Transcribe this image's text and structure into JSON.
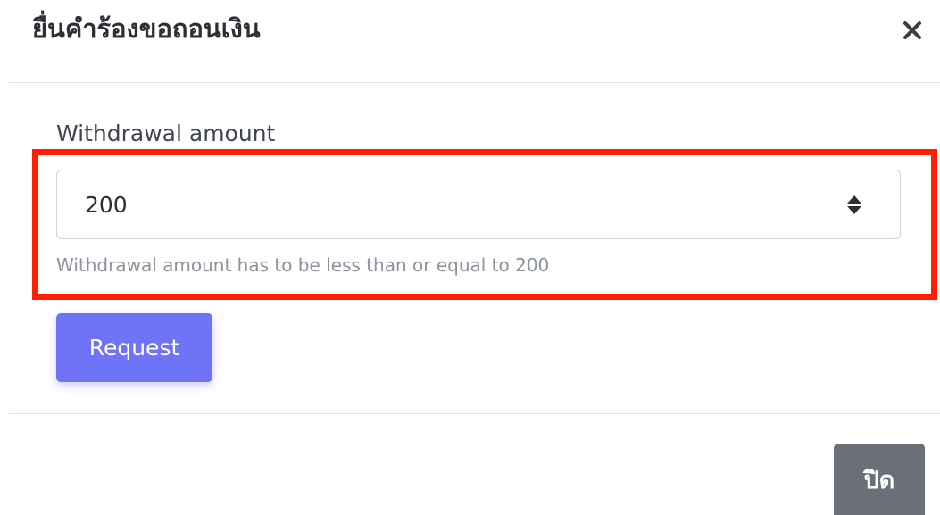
{
  "modal": {
    "title": "ยื่นคำร้องขอถอนเงิน",
    "close_icon": "close-icon"
  },
  "form": {
    "amount_label": "Withdrawal amount",
    "amount_value": "200",
    "help_text": "Withdrawal amount has to be less than or equal to 200",
    "request_label": "Request"
  },
  "footer": {
    "close_label": "ปิด"
  },
  "colors": {
    "highlight": "#ff1f05",
    "primary": "#6f73f5",
    "secondary": "#6b7078"
  }
}
